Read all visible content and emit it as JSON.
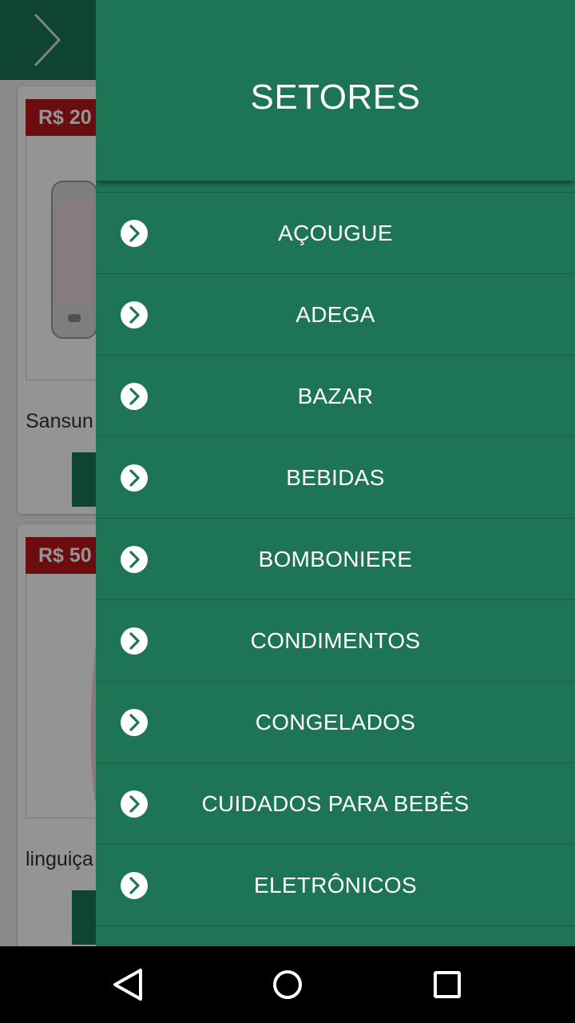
{
  "background": {
    "cards": [
      {
        "price": "R$ 20",
        "name": "Sansun"
      },
      {
        "price": "R$ 50",
        "name": "linguiça"
      }
    ]
  },
  "drawer": {
    "title": "SETORES",
    "items": [
      {
        "label": "AÇOUGUE",
        "icon": "chevron-right-circle-icon"
      },
      {
        "label": "ADEGA",
        "icon": "chevron-right-circle-icon"
      },
      {
        "label": "BAZAR",
        "icon": "chevron-right-circle-icon"
      },
      {
        "label": "BEBIDAS",
        "icon": "chevron-right-circle-icon"
      },
      {
        "label": "BOMBONIERE",
        "icon": "chevron-right-circle-icon"
      },
      {
        "label": "CONDIMENTOS",
        "icon": "chevron-right-circle-icon"
      },
      {
        "label": "CONGELADOS",
        "icon": "chevron-right-circle-icon"
      },
      {
        "label": "CUIDADOS PARA BEBÊS",
        "icon": "chevron-right-circle-icon"
      },
      {
        "label": "ELETRÔNICOS",
        "icon": "chevron-right-circle-icon"
      }
    ]
  },
  "navigation": {
    "back_icon": "back-triangle-icon",
    "home_icon": "home-circle-icon",
    "recent_icon": "recent-apps-square-icon"
  },
  "colors": {
    "primary": "#1d7556",
    "price_tag": "#b8171b",
    "nav_bar": "#000000"
  }
}
